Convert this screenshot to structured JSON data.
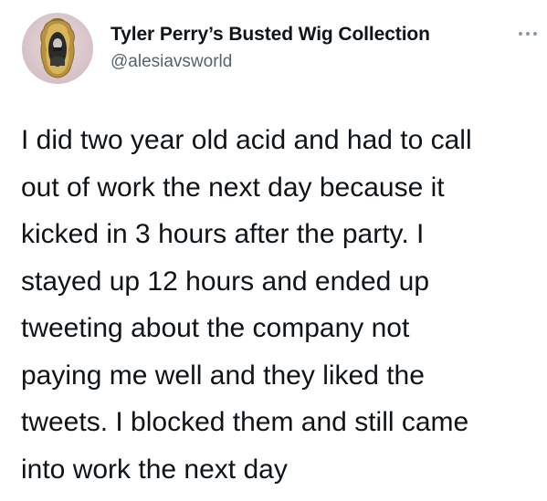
{
  "tweet": {
    "author": {
      "display_name": "Tyler Perry’s Busted Wig Collection",
      "handle": "@alesiavsworld",
      "avatar_icon": "framed-portrait-avatar"
    },
    "more_icon": "more-options-icon",
    "text_lines": [
      "I did two year old acid and had to call",
      "out of work the next day because it",
      "kicked in 3 hours after the party. I",
      "stayed up 12 hours and ended up",
      "tweeting about the company not",
      "paying me well and they liked the",
      "tweets. I blocked them and still came",
      "into work the next day"
    ]
  },
  "colors": {
    "text": "#0f1419",
    "secondary": "#536471",
    "background": "#ffffff"
  }
}
